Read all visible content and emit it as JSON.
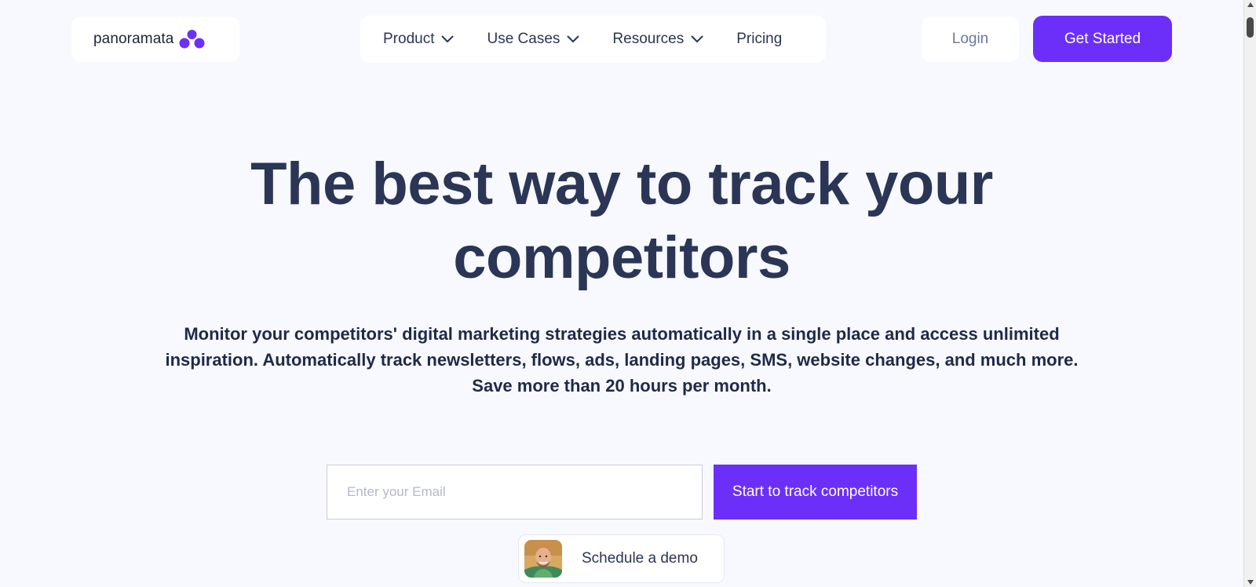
{
  "brand": {
    "name": "panoramata",
    "accent_color": "#6c2ffa",
    "logo_icon": "three-circles-logo-icon"
  },
  "nav": {
    "items": [
      {
        "label": "Product",
        "icon": "chevron-down-icon"
      },
      {
        "label": "Use Cases",
        "icon": "chevron-down-icon"
      },
      {
        "label": "Resources",
        "icon": "chevron-down-icon"
      },
      {
        "label": "Pricing"
      }
    ]
  },
  "header": {
    "login_label": "Login",
    "get_started_label": "Get Started"
  },
  "hero": {
    "title_line1": "The best way to track your",
    "title_line2": "competitors",
    "subtitle": "Monitor your competitors' digital marketing strategies automatically in a single place and access unlimited inspiration. Automatically track newsletters, flows, ads, landing pages, SMS, website changes, and much more. Save more than 20 hours per month."
  },
  "form": {
    "email_placeholder": "Enter your Email",
    "email_value": "",
    "submit_label": "Start to track competitors"
  },
  "demo": {
    "label": "Schedule a demo",
    "avatar_icon": "person-avatar"
  },
  "colors": {
    "background": "#f8f9fe",
    "text_dark": "#2b3656",
    "login_text": "#6b7a9c"
  }
}
